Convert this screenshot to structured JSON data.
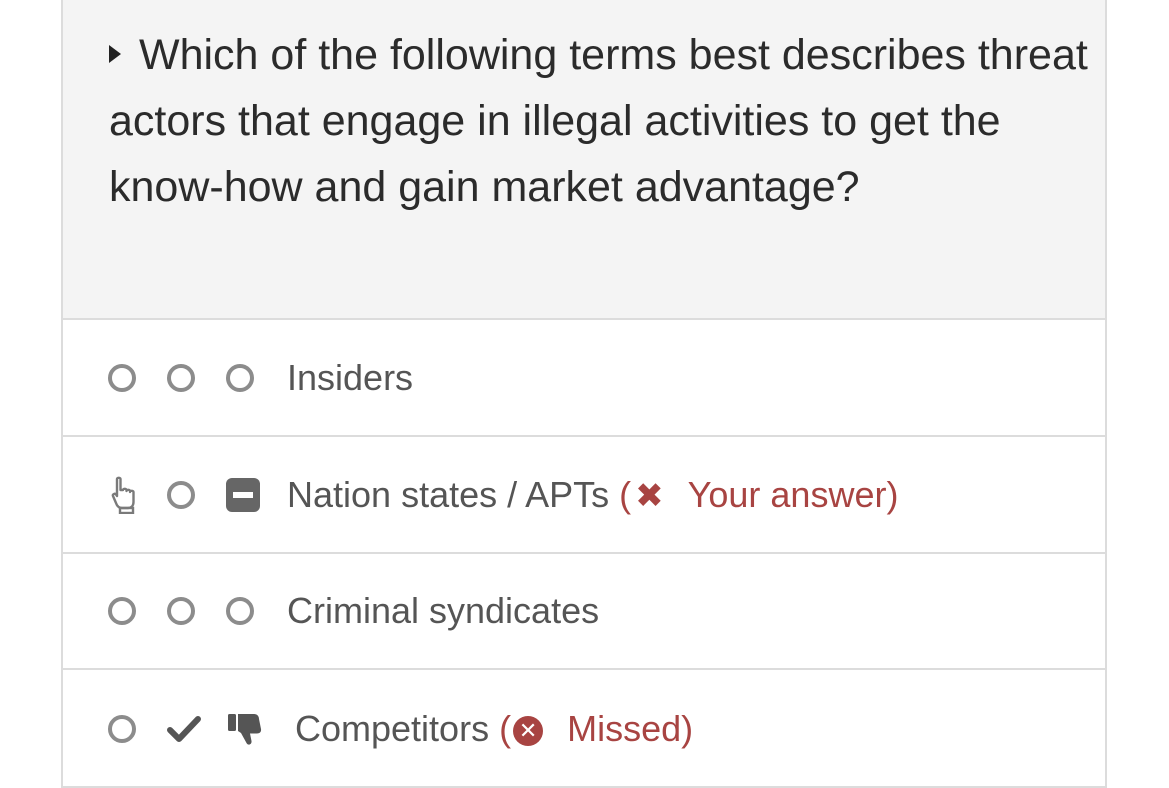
{
  "question": {
    "text": "Which of the following terms best describes threat actors that engage in illegal activities to get the know-how and gain market advantage?"
  },
  "options": [
    {
      "label": "Insiders"
    },
    {
      "label": "Nation states / APTs",
      "feedback_open": "(",
      "feedback_text": "Your answer)",
      "feedback_icon": "x-mark-icon"
    },
    {
      "label": "Criminal syndicates"
    },
    {
      "label": "Competitors",
      "feedback_open": "(",
      "feedback_text": "Missed)",
      "feedback_icon": "x-circle-icon"
    }
  ],
  "colors": {
    "feedback": "#a84442",
    "question_bg": "#f4f4f4",
    "border": "#dcdcdc"
  }
}
